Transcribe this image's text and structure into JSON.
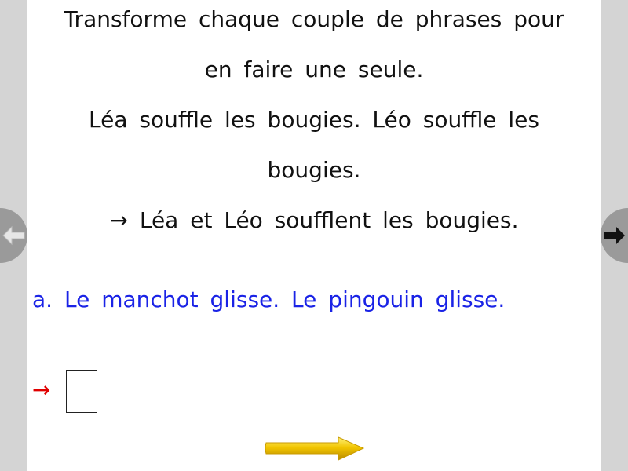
{
  "instruction": {
    "line1": "Transforme chaque couple de phrases pour",
    "line2": "en faire une seule.",
    "example_line1": "Léa souffle les bougies. Léo souffle les",
    "example_line2": "bougies.",
    "example_answer": "→ Léa et Léo soufflent les bougies."
  },
  "exercise": {
    "question": "a. Le manchot glisse. Le pingouin glisse.",
    "answer_arrow": "→",
    "answer_value": ""
  },
  "navigation": {
    "prev_icon": "arrow-left-icon",
    "next_icon": "arrow-right-icon",
    "next_exercise_icon": "yellow-arrow-icon"
  },
  "colors": {
    "question": "#1a23e6",
    "answer_arrow": "#e00000",
    "side_panel": "#d4d4d4",
    "nav_button": "#9a9a9a",
    "next_exercise_arrow": "#f2c500"
  }
}
